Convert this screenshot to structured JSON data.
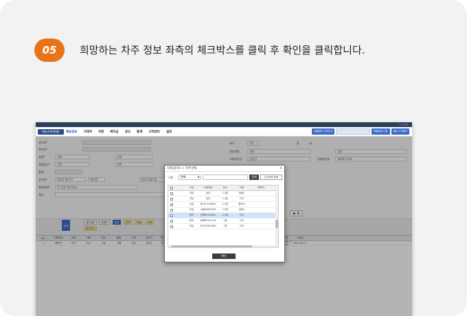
{
  "step": {
    "number": "05",
    "instruction": "희망하는 차주 정보 좌측의 체크박스를 클릭 후 확인을 클릭합니다."
  },
  "colors": {
    "accent": "#e8741a",
    "app_titlebar": "#2c3e5c",
    "primary_button": "#2d4b8c",
    "selected_row": "#cfe4fa"
  },
  "app": {
    "menu_button": "배송조회(화물)",
    "menu_items": [
      "배송정보",
      "거래처",
      "차량",
      "배차금",
      "정산",
      "통계",
      "고객센터",
      "설정"
    ],
    "right_buttons": [
      "화물정보 가져오기",
      "화물등록 다운",
      "배송 고객정보"
    ],
    "form": {
      "left_labels": [
        "상차지*",
        "하차지*",
        "차종*",
        "지불방식*",
        "중량*",
        "상차일*",
        "화물명세*",
        "적요"
      ],
      "combo_values": [
        "선택",
        "선택",
        "선택",
        "선택"
      ],
      "date_values": [
        "2022-08-17",
        "08:00",
        "2022-08-18"
      ],
      "remark": "주 운행 일정 출고",
      "right_labels": [
        "대수",
        "정산방법",
        "거래처담당",
        "휴대폰번호"
      ],
      "count_value": "1대",
      "method_value": "일반",
      "contact_name": "김담당",
      "phone_value": "1800-1234",
      "radio_options": [
        "톤",
        "대"
      ]
    },
    "grid_toolbar": {
      "buttons": [
        "전체",
        "배차완료",
        "배차대기",
        "미배차",
        "정산",
        "선택",
        "엑셀",
        "인쇄"
      ],
      "page": "2"
    },
    "grid": {
      "headers": [
        "No.",
        "진행상태",
        "상세",
        "차종",
        "톤수",
        "출발",
        "도착",
        "상차지",
        "하차지",
        "화물명세",
        "배차기사",
        "연락처",
        "운임",
        "결제",
        "정산",
        "비고",
        "등록일",
        "수정일"
      ],
      "row": [
        "1",
        "배차전",
        "보기",
        "카고",
        "5톤",
        "서울",
        "부산",
        "창고A",
        "창고B",
        "일반",
        "",
        "",
        "300,000",
        "후불",
        "",
        "",
        "2022-08-17 09:00",
        "2022-08-17"
      ]
    }
  },
  "dialog": {
    "title": "차적(용차) > 차주선택",
    "close": "×",
    "search_label": "구분",
    "search_select": "전체",
    "search_button": "검색",
    "new_button": "신규차량 등록",
    "columns": [
      "",
      "구분",
      "차량번호",
      "톤수",
      "차종",
      "연락처"
    ],
    "rows": [
      {
        "type": "지입",
        "number": "공간",
        "ton": "1.4톤",
        "kind": "냉동C",
        "selected": false
      },
      {
        "type": "지입",
        "number": "공간",
        "ton": "1.4톤",
        "kind": "카고",
        "selected": false
      },
      {
        "type": "지입",
        "number": "경기17다8855",
        "ton": "2.5톤",
        "kind": "윙바디",
        "selected": false
      },
      {
        "type": "지입",
        "number": "서울18라5555",
        "ton": "2.5톤",
        "kind": "냉동C",
        "selected": false
      },
      {
        "type": "용차",
        "number": "전북80사8050",
        "ton": "2.5톤",
        "kind": "카고",
        "selected": true
      },
      {
        "type": "용차",
        "number": "경북67러1234",
        "ton": "1톤",
        "kind": "카고",
        "selected": false
      },
      {
        "type": "지입",
        "number": "경기12바3456",
        "ton": "1톤",
        "kind": "카고",
        "selected": false
      }
    ],
    "ok_button": "확인"
  }
}
